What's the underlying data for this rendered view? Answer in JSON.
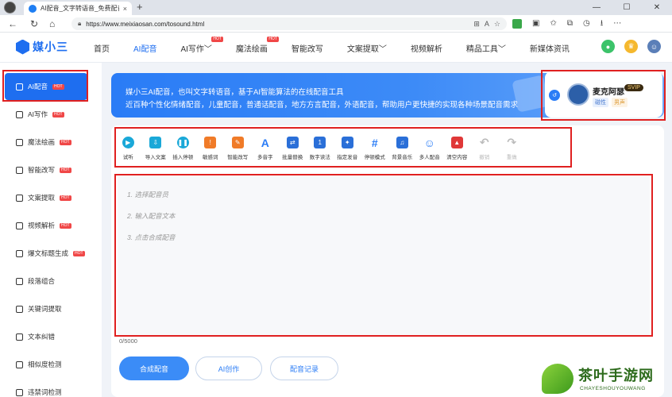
{
  "browser": {
    "tab_title": "AI配音_文字转语音_免费配音在线",
    "tab_close": "×",
    "new_tab": "+",
    "url": "https://www.meixiaosan.com/tosound.html",
    "win_minimize": "—",
    "win_maximize": "☐",
    "win_close": "✕"
  },
  "site": {
    "logo_text": "媒小三",
    "nav": [
      {
        "label": "首页"
      },
      {
        "label": "AI配音"
      },
      {
        "label": "AI写作",
        "hot": "HOT"
      },
      {
        "label": "魔法绘画",
        "hot": "HOT"
      },
      {
        "label": "智能改写"
      },
      {
        "label": "文案提取"
      },
      {
        "label": "视频解析"
      },
      {
        "label": "精品工具"
      },
      {
        "label": "新媒体资讯"
      }
    ]
  },
  "sidebar": {
    "items": [
      {
        "label": "AI配音",
        "hot": "HOT"
      },
      {
        "label": "AI写作",
        "hot": "HOT"
      },
      {
        "label": "魔法绘画",
        "hot": "HOT"
      },
      {
        "label": "智能改写",
        "hot": "HOT"
      },
      {
        "label": "文案提取",
        "hot": "HOT"
      },
      {
        "label": "视频解析",
        "hot": "HOT"
      },
      {
        "label": "爆文标题生成",
        "hot": "HOT"
      },
      {
        "label": "段落组合"
      },
      {
        "label": "关键词提取"
      },
      {
        "label": "文本纠错"
      },
      {
        "label": "相似度检测"
      },
      {
        "label": "违禁词检测"
      }
    ]
  },
  "banner": {
    "line1": "媒小三AI配音，也叫文字转语音，基于AI智能算法的在线配音工具",
    "line2": "近百种个性化情绪配音，儿童配音，普通话配音，地方方言配音，外语配音，帮助用户更快捷的实现各种场景配音需求"
  },
  "user": {
    "name": "麦克阿瑟",
    "level": "SVIP",
    "tag1": "磁性",
    "tag2": "男声"
  },
  "toolbar": [
    {
      "label": "试听",
      "icon": "play-icon",
      "color": "#1aa8d8"
    },
    {
      "label": "导入文案",
      "icon": "import-icon",
      "color": "#1aa8d8"
    },
    {
      "label": "插入停顿",
      "icon": "pause-icon",
      "color": "#1aa8d8"
    },
    {
      "label": "敏感词",
      "icon": "sensitive-icon",
      "color": "#f07b28"
    },
    {
      "label": "智能改写",
      "icon": "rewrite-icon",
      "color": "#f07b28"
    },
    {
      "label": "多音字",
      "icon": "polyphone-icon",
      "color": "#2a6fd8"
    },
    {
      "label": "批量替换",
      "icon": "replace-icon",
      "color": "#2a6fd8"
    },
    {
      "label": "数字读法",
      "icon": "number-icon",
      "color": "#2a6fd8"
    },
    {
      "label": "指定发音",
      "icon": "pronounce-icon",
      "color": "#2a6fd8"
    },
    {
      "label": "停顿模式",
      "icon": "pause-mode-icon",
      "color": "#2a6fd8"
    },
    {
      "label": "背景音乐",
      "icon": "music-icon",
      "color": "#2a6fd8"
    },
    {
      "label": "多人配音",
      "icon": "multi-voice-icon",
      "color": "#2a6fd8"
    },
    {
      "label": "清空内容",
      "icon": "clear-icon",
      "color": "#e03838"
    },
    {
      "label": "撤销",
      "icon": "undo-icon",
      "color": "#bbbbbb"
    },
    {
      "label": "重做",
      "icon": "redo-icon",
      "color": "#bbbbbb"
    }
  ],
  "editor": {
    "hint1": "1. 选择配音员",
    "hint2": "2. 输入配音文本",
    "hint3": "3. 点击合成配音",
    "counter": "0/5000"
  },
  "actions": {
    "primary": "合成配音",
    "ai_create": "AI创作",
    "records": "配音记录"
  },
  "watermark": {
    "title": "茶叶手游网",
    "sub": "CHAYESHOUYOUWANG"
  },
  "colors": {
    "accent": "#1e6ef0",
    "highlight_box": "#e02020"
  }
}
